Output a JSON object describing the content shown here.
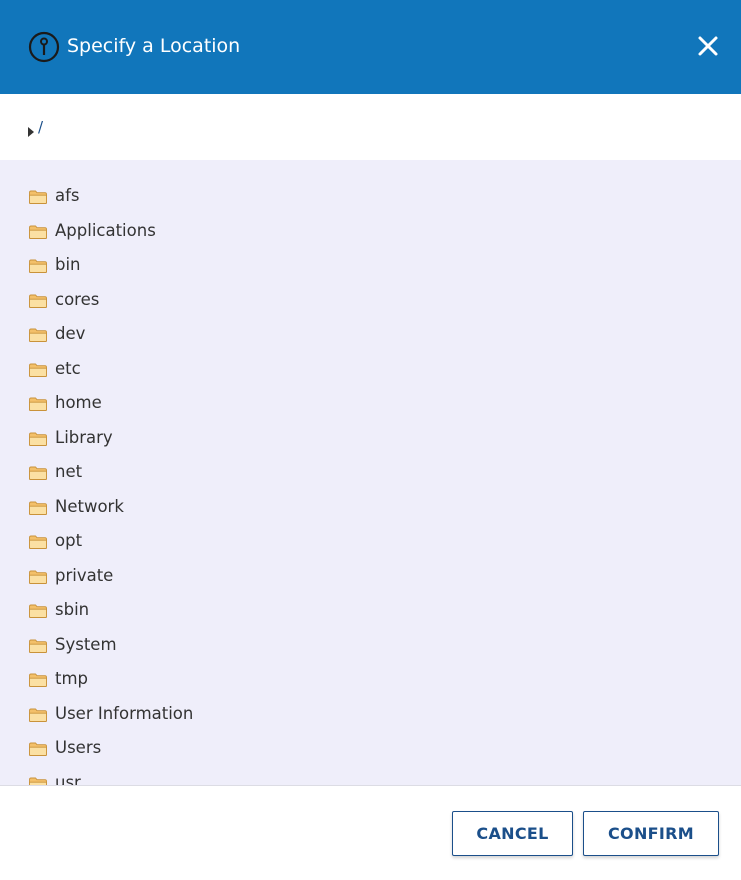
{
  "dialog": {
    "title": "Specify a Location",
    "header_color": "#1176bb",
    "icons": {
      "info": "info-circle-icon",
      "close": "close-icon"
    }
  },
  "path": {
    "current": "/",
    "expand_icon": "caret-right-icon"
  },
  "folder_list": {
    "background": "#efeefa",
    "icon": "folder-icon",
    "items": [
      "afs",
      "Applications",
      "bin",
      "cores",
      "dev",
      "etc",
      "home",
      "Library",
      "net",
      "Network",
      "opt",
      "private",
      "sbin",
      "System",
      "tmp",
      "User Information",
      "Users",
      "usr"
    ]
  },
  "footer": {
    "cancel_label": "CANCEL",
    "confirm_label": "CONFIRM",
    "button_color": "#1b4f8a"
  }
}
